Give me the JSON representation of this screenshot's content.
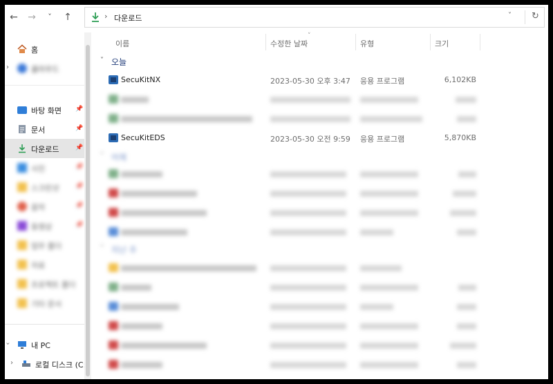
{
  "window": {
    "path": "다운로드"
  },
  "nav_buttons": {
    "back": "←",
    "forward": "→",
    "recent": "˅",
    "up": "↑",
    "address_dropdown": "˅",
    "refresh": "↻"
  },
  "sidebar": {
    "home": "홈",
    "blurred_cloud": "클라우드",
    "desktop": "바탕 화면",
    "documents": "문서",
    "downloads": "다운로드",
    "blurred_items": [
      "사진",
      "스크린샷",
      "음악",
      "동영상",
      "업무 폴더",
      "자료",
      "프로젝트 폴더",
      "기타 문서"
    ],
    "this_pc": "내 PC",
    "local_disk": "로컬 디스크 (C:)"
  },
  "columns": {
    "name": "이름",
    "date": "수정한 날짜",
    "type": "유형",
    "size": "크기"
  },
  "groups": {
    "today": "오늘",
    "blurred_group1": "어제",
    "blurred_group2": "지난 주"
  },
  "files": [
    {
      "name": "SecuKitNX",
      "date": "2023-05-30 오후 3:47",
      "type": "응용 프로그램",
      "size": "6,102KB"
    },
    {
      "name": "SecuKitEDS",
      "date": "2023-05-30 오전 9:59",
      "type": "응용 프로그램",
      "size": "5,870KB"
    }
  ],
  "colors": {
    "selected_bg": "#e5e5e5",
    "group_text": "#1e3a78",
    "download_green": "#2e9e55",
    "folder_yellow": "#f2c14e",
    "edge_red": "#d04a4a"
  }
}
